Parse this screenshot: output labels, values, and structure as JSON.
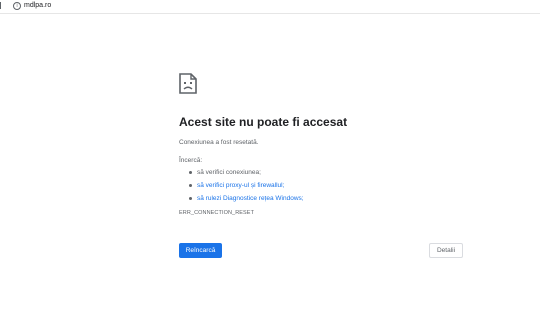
{
  "addressbar": {
    "url": "mdlpa.ro",
    "info_icon": "info-circle-icon"
  },
  "error_page": {
    "icon": "sad-document-icon",
    "title": "Acest site nu poate fi accesat",
    "subtitle": "Conexiunea a fost resetată.",
    "try_label": "Încercă:",
    "tips": [
      {
        "text": "să verifici conexiunea;",
        "link": false
      },
      {
        "text": "să verifici proxy-ul și firewallul;",
        "link": true
      },
      {
        "text": "să rulezi Diagnostice rețea Windows;",
        "link": true
      }
    ],
    "error_code": "ERR_CONNECTION_RESET",
    "reload_label": "Reîncarcă",
    "details_label": "Detalii"
  },
  "colors": {
    "accent": "#1a73e8",
    "text_primary": "#202124",
    "text_secondary": "#5f6368"
  }
}
